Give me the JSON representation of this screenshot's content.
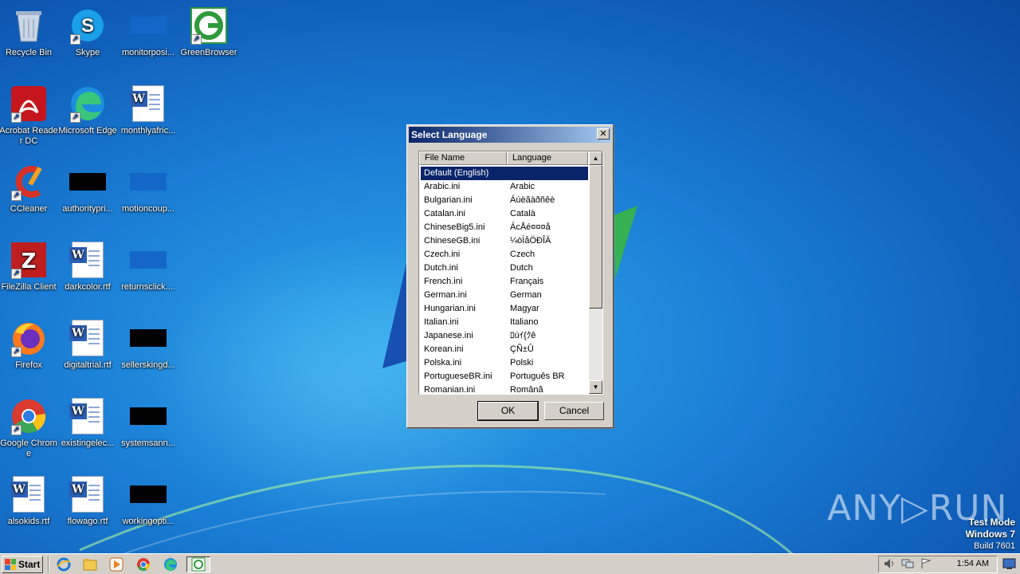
{
  "desktop_icons": [
    {
      "name": "recycle-bin",
      "label": "Recycle Bin"
    },
    {
      "name": "skype",
      "label": "Skype"
    },
    {
      "name": "monitorposi",
      "label": "monitorposi..."
    },
    {
      "name": "greenbrowser",
      "label": "GreenBrowser"
    },
    {
      "name": "acrobat",
      "label": "Acrobat Reader DC"
    },
    {
      "name": "edge",
      "label": "Microsoft Edge"
    },
    {
      "name": "monthlyafric",
      "label": "monthlyafric..."
    },
    {
      "name": "ccleaner",
      "label": "CCleaner"
    },
    {
      "name": "authoritypri",
      "label": "authoritypri..."
    },
    {
      "name": "motioncoup",
      "label": "motioncoup..."
    },
    {
      "name": "filezilla",
      "label": "FileZilla Client"
    },
    {
      "name": "darkcolor",
      "label": "darkcolor.rtf"
    },
    {
      "name": "returnsclick",
      "label": "returnsclick...."
    },
    {
      "name": "firefox",
      "label": "Firefox"
    },
    {
      "name": "digitaltrial",
      "label": "digitaltrial.rtf"
    },
    {
      "name": "sellerskingd",
      "label": "sellerskingd..."
    },
    {
      "name": "chrome",
      "label": "Google Chrome"
    },
    {
      "name": "existingelec",
      "label": "existingelec..."
    },
    {
      "name": "systemsann",
      "label": "systemsann..."
    },
    {
      "name": "alsokids",
      "label": "alsokids.rtf"
    },
    {
      "name": "flowago",
      "label": "flowago.rtf"
    },
    {
      "name": "workingopti",
      "label": "workingopti..."
    }
  ],
  "dialog": {
    "title": "Select Language",
    "close_symbol": "✕",
    "columns": [
      "File Name",
      "Language"
    ],
    "rows": [
      {
        "file": "Default (English)",
        "lang": "",
        "selected": true
      },
      {
        "file": "Arabic.ini",
        "lang": "Arabic"
      },
      {
        "file": "Bulgarian.ini",
        "lang": "Áúëãàðñêè"
      },
      {
        "file": "Catalan.ini",
        "lang": "Català"
      },
      {
        "file": "ChineseBig5.ini",
        "lang": "ÁcÅé¤¤¤å"
      },
      {
        "file": "ChineseGB.ini",
        "lang": "¼òÌåÖÐÎÄ"
      },
      {
        "file": "Czech.ini",
        "lang": "Czech"
      },
      {
        "file": "Dutch.ini",
        "lang": "Dutch"
      },
      {
        "file": "French.ini",
        "lang": "Français"
      },
      {
        "file": "German.ini",
        "lang": "German"
      },
      {
        "file": "Hungarian.ini",
        "lang": "Magyar"
      },
      {
        "file": "Italian.ini",
        "lang": "Italiano"
      },
      {
        "file": "Japanese.ini",
        "lang": "ﾛúｲ{ｸê"
      },
      {
        "file": "Korean.ini",
        "lang": "ÇÑ±Û"
      },
      {
        "file": "Polska.ini",
        "lang": "Polski"
      },
      {
        "file": "PortugueseBR.ini",
        "lang": "Português BR"
      },
      {
        "file": "Romanian.ini",
        "lang": "Românã"
      }
    ],
    "ok_label": "OK",
    "cancel_label": "Cancel"
  },
  "watermark": {
    "brand": "ANY▷RUN",
    "test_mode": "Test Mode",
    "os": "Windows 7",
    "build": "Build 7601"
  },
  "taskbar": {
    "start_label": "Start",
    "clock": "1:54 AM"
  },
  "colors": {
    "selection": "#0a246a",
    "dialog_face": "#d4d0c8",
    "desktop_blue": "#1b7fd6"
  }
}
